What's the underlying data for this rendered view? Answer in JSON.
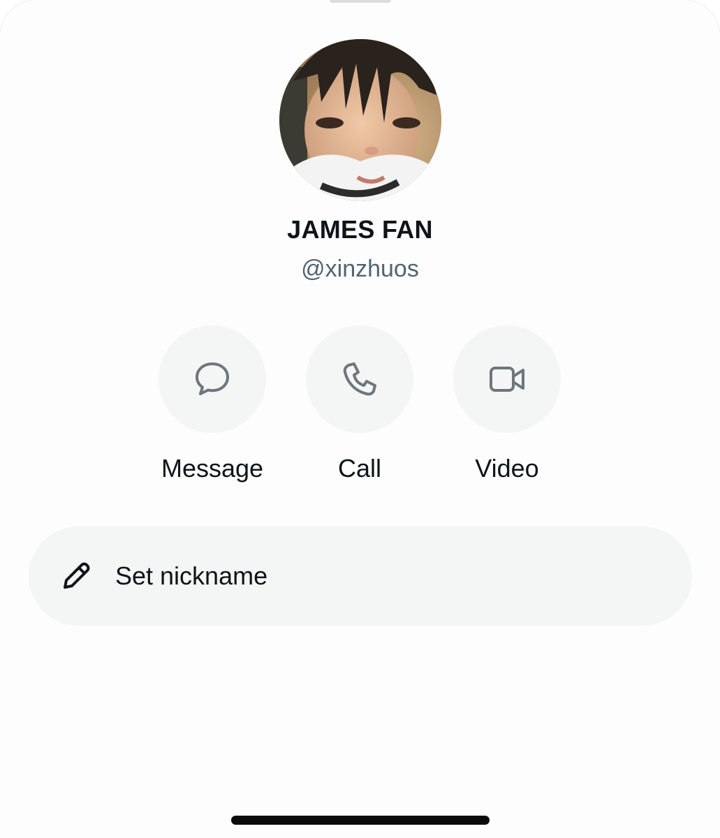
{
  "profile": {
    "display_name": "JAMES FAN",
    "handle": "@xinzhuos",
    "avatar_description": "profile-photo"
  },
  "actions": [
    {
      "label": "Message",
      "icon": "chat-bubble-icon"
    },
    {
      "label": "Call",
      "icon": "phone-icon"
    },
    {
      "label": "Video",
      "icon": "video-camera-icon"
    }
  ],
  "nickname": {
    "label": "Set nickname",
    "icon": "pencil-icon"
  },
  "colors": {
    "text_primary": "#0f1419",
    "text_secondary": "#536471",
    "button_bg": "#f4f5f5",
    "icon_gray": "#6e767d"
  }
}
